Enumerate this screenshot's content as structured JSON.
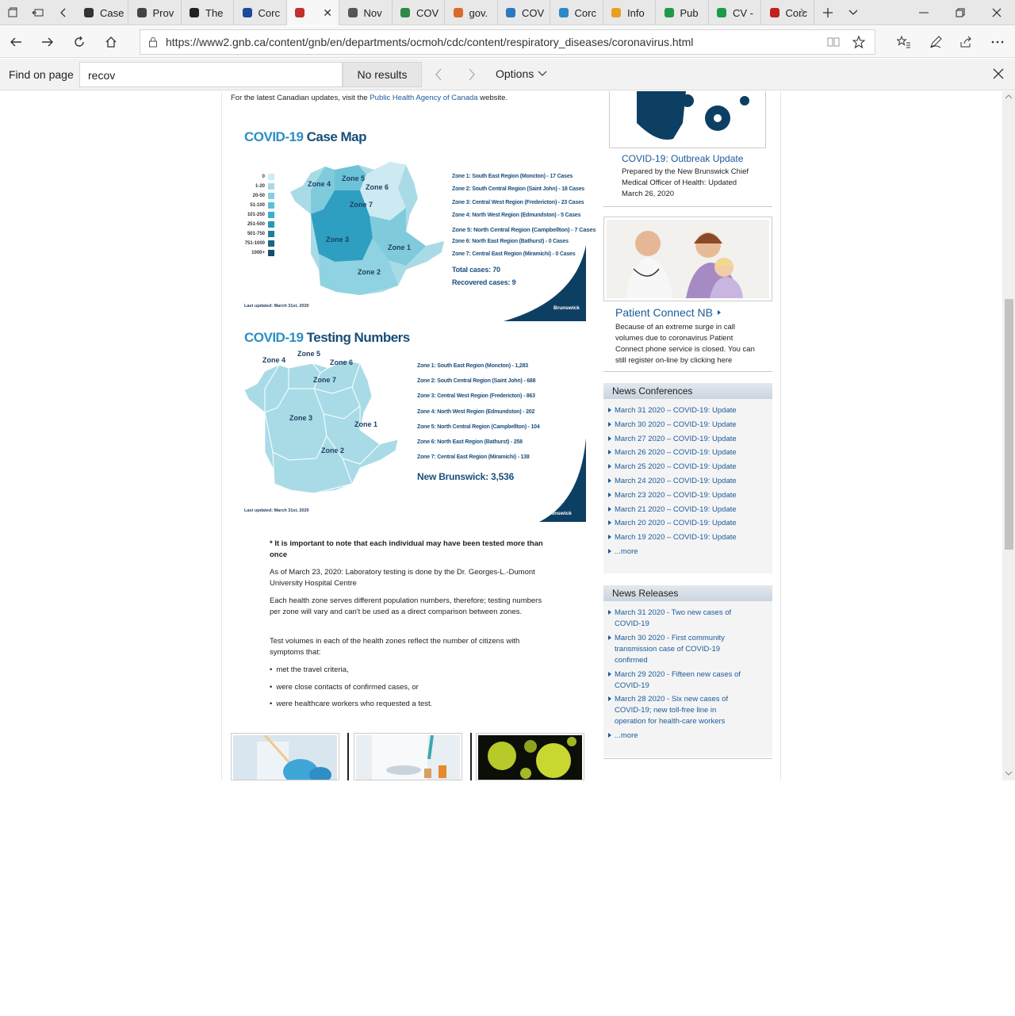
{
  "browser": {
    "tabs": [
      {
        "label": "Case",
        "icon": "doc-icon"
      },
      {
        "label": "Prov",
        "icon": "pig-icon"
      },
      {
        "label": "The",
        "icon": "shield-icon"
      },
      {
        "label": "Corc",
        "icon": "fleurdelis-icon"
      },
      {
        "label": "",
        "icon": "ribbon-icon",
        "active": true
      },
      {
        "label": "Nov",
        "icon": "mail-icon"
      },
      {
        "label": "COV",
        "icon": "hands-icon"
      },
      {
        "label": "gov.",
        "icon": "flower-icon"
      },
      {
        "label": "COV",
        "icon": "globe-icon"
      },
      {
        "label": "Corc",
        "icon": "wave-icon"
      },
      {
        "label": "Info",
        "icon": "arch-icon"
      },
      {
        "label": "Pub",
        "icon": "plus-cross-icon"
      },
      {
        "label": "CV -",
        "icon": "plus-cross-icon"
      },
      {
        "label": "Corc",
        "icon": "maple-leaf-icon"
      }
    ],
    "url": "https://www2.gnb.ca/content/gnb/en/departments/ocmoh/cdc/content/respiratory_diseases/coronavirus.html",
    "url_domain": "www2.gnb.ca",
    "find": {
      "label": "Find on page",
      "query": "recov",
      "results": "No results",
      "options": "Options"
    }
  },
  "page": {
    "intro_prefix": "For the latest Canadian updates, visit the ",
    "intro_link": "Public Health Agency of Canada",
    "intro_suffix": " website.",
    "case_map": {
      "title_a": "COVID-19",
      "title_b": " Case Map",
      "legend": [
        "0",
        "1-20",
        "20-50",
        "51-100",
        "101-250",
        "251-500",
        "501-750",
        "751-1000",
        "1000+"
      ],
      "legend_colors": [
        "#cfeaf3",
        "#a8dbe8",
        "#86cfe0",
        "#5fbfd6",
        "#3aaecb",
        "#2a97b6",
        "#1f7f9c",
        "#176883",
        "#11506a"
      ],
      "zones": [
        "Zone 1: South East Region (Moncton) - 17 Cases",
        "Zone 2: South Central Region (Saint John) - 18 Cases",
        "Zone 3: Central West Region (Fredericton) - 23 Cases",
        "Zone 4: North West Region (Edmundston) - 5 Cases",
        "Zone 5: North Central Region (Campbellton) - 7 Cases",
        "Zone 6: North East Region (Bathurst) - 0 Cases",
        "Zone 7: Central East Region (Miramichi) - 0 Cases"
      ],
      "zone_labels": [
        "Zone 4",
        "Zone 5",
        "Zone 6",
        "Zone 7",
        "Zone 3",
        "Zone 1",
        "Zone 2"
      ],
      "total": "Total cases: 70",
      "recovered": "Recovered cases: 9",
      "updated": "Last updated: March 31st, 2020",
      "logo": "Brunswick"
    },
    "testing_map": {
      "title_a": "COVID-19",
      "title_b": " Testing Numbers",
      "zones": [
        "Zone 1: South East Region (Moncton) - 1,283",
        "Zone 2: South Central Region (Saint John) - 688",
        "Zone 3: Central West Region (Fredericton) - 863",
        "Zone 4: North West Region (Edmundston) - 202",
        "Zone 5: North Central Region (Campbellton) - 104",
        "Zone 6: North East Region (Bathurst) - 258",
        "Zone 7: Central East Region (Miramichi) - 138"
      ],
      "zone_labels": [
        "Zone 4",
        "Zone 5",
        "Zone 6",
        "Zone 7",
        "Zone 3",
        "Zone 1",
        "Zone 2"
      ],
      "total": "New Brunswick: 3,536",
      "updated": "Last updated: March 31st, 2020",
      "logo": "Brunswick"
    },
    "note_bold": "* It is important to note that each individual may have been tested more than once",
    "para1": "As of March 23, 2020: Laboratory testing is done by the Dr. Georges-L.-Dumont University Hospital Centre",
    "para2": "Each health zone serves different population numbers, therefore; testing numbers per zone will vary and can't be used as a direct comparison between zones.",
    "para3": "Test volumes in each of the health zones reflect the number of citizens with symptoms that:",
    "bullets": [
      "met the travel criteria,",
      "were close contacts of confirmed cases, or",
      "were healthcare workers who requested a test."
    ]
  },
  "sidebar": {
    "outbreak_title": "COVID-19: Outbreak Update",
    "outbreak_desc": "Prepared by the New Brunswick Chief Medical Officer of Health: Updated March 26, 2020",
    "patient_title": "Patient Connect NB",
    "patient_desc": "Because of an extreme surge in call volumes due to coronavirus Patient Connect phone service is closed. You can still register on-line by clicking here",
    "conferences_title": "News Conferences",
    "conferences": [
      "March 31 2020 – COVID-19: Update",
      "March 30 2020 – COVID-19: Update",
      "March 27 2020 – COVID-19: Update",
      "March 26 2020 – COVID-19: Update",
      "March 25 2020 – COVID-19: Update",
      "March 24 2020 – COVID-19: Update",
      "March 23 2020 – COVID-19: Update",
      "March 21 2020 – COVID-19: Update",
      "March 20 2020 – COVID-19: Update",
      "March 19 2020 – COVID-19: Update",
      "...more"
    ],
    "releases_title": "News Releases",
    "releases": [
      "March 31 2020 - Two new cases of COVID-19",
      "March 30 2020 - First community transmission case of COVID-19 confirmed",
      "March 29 2020 - Fifteen new cases of COVID-19",
      "March 28 2020 - Six new cases of COVID-19; new toll-free line in operation for health-care workers",
      "...more"
    ]
  }
}
